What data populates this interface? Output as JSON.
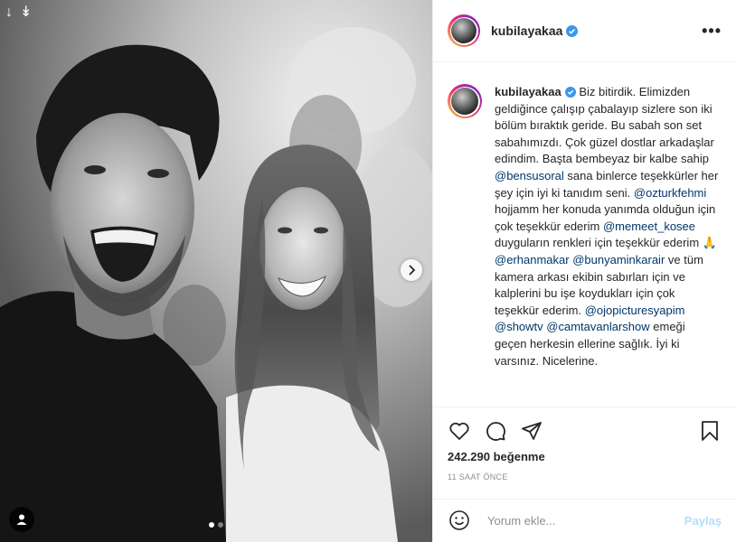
{
  "media": {
    "carousel_count": 2,
    "active_index": 0
  },
  "header": {
    "username": "kubilayakaa",
    "verified": true,
    "more_label": "•••"
  },
  "caption": {
    "username": "kubilayakaa",
    "parts": [
      {
        "type": "text",
        "text": " Biz bitirdik. Elimizden geldiğince çalışıp çabalayıp sizlere son iki bölüm bıraktık geride. Bu sabah son set sabahımızdı. Çok güzel dostlar arkadaşlar edindim. Başta bembeyaz bir kalbe sahip "
      },
      {
        "type": "mention",
        "text": "@bensusoral"
      },
      {
        "type": "text",
        "text": " sana binlerce teşekkürler her şey için iyi ki tanıdım seni. "
      },
      {
        "type": "mention",
        "text": "@ozturkfehmi"
      },
      {
        "type": "text",
        "text": " hojjamm her konuda yanımda olduğun için çok teşekkür ederim "
      },
      {
        "type": "mention",
        "text": "@memeet_kosee"
      },
      {
        "type": "text",
        "text": " duyguların renkleri için teşekkür ederim 🙏 "
      },
      {
        "type": "mention",
        "text": "@erhanmakar"
      },
      {
        "type": "text",
        "text": " "
      },
      {
        "type": "mention",
        "text": "@bunyaminkarair"
      },
      {
        "type": "text",
        "text": " ve tüm kamera arkası ekibin sabırları için ve kalplerini bu işe koydukları için çok teşekkür ederim. "
      },
      {
        "type": "mention",
        "text": "@ojopicturesyapim"
      },
      {
        "type": "text",
        "text": " "
      },
      {
        "type": "mention",
        "text": "@showtv"
      },
      {
        "type": "text",
        "text": " "
      },
      {
        "type": "mention",
        "text": "@camtavanlarshow"
      },
      {
        "type": "text",
        "text": " emeği geçen herkesin ellerine sağlık. İyi ki varsınız. Nicelerine."
      }
    ]
  },
  "stats": {
    "likes_label": "242.290 beğenme",
    "time_label": "11 SAAT ÖNCE"
  },
  "comment": {
    "placeholder": "Yorum ekle...",
    "post_label": "Paylaş"
  },
  "colors": {
    "mention": "#00376b",
    "verified": "#3897f0",
    "post_disabled": "#b2dffc",
    "muted": "#8e8e8e"
  }
}
